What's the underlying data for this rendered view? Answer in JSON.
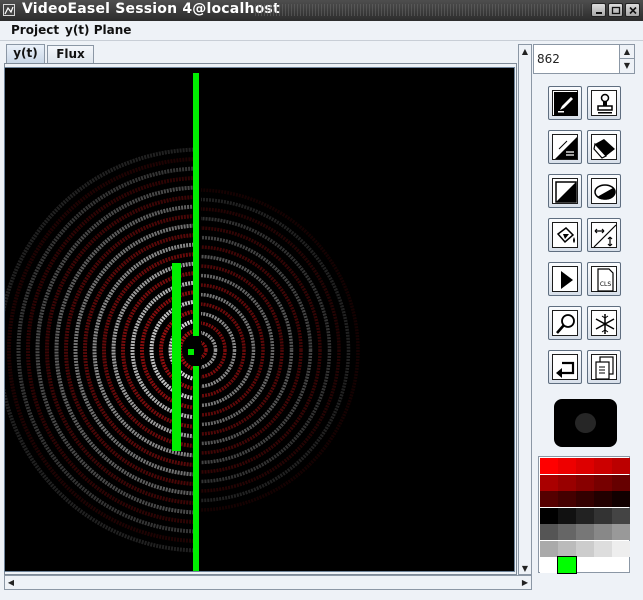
{
  "window": {
    "title": "VideoEasel Session 4@localhost"
  },
  "menubar": {
    "items": [
      "Project",
      "y(t) Plane"
    ]
  },
  "tabs": [
    {
      "label": "y(t)",
      "active": true
    },
    {
      "label": "Flux",
      "active": false
    }
  ],
  "spinner": {
    "value": "862"
  },
  "tools": [
    "pencil-icon",
    "stamp-icon",
    "gradient-fill-icon",
    "eraser-icon",
    "rectangle-icon",
    "ellipse-icon",
    "paint-bucket-icon",
    "resize-icon",
    "play-icon",
    "clear-screen-icon",
    "zoom-icon",
    "freeze-icon",
    "undo-icon",
    "copy-icon"
  ],
  "tool_labels": {
    "clear": "CLS"
  },
  "palette": {
    "selected": "#00ff00",
    "colors": [
      [
        "#ff0000",
        "#ee0000",
        "#dd0000",
        "#cc0000",
        "#bb0000"
      ],
      [
        "#aa0000",
        "#990000",
        "#880000",
        "#770000",
        "#660000"
      ],
      [
        "#550000",
        "#440000",
        "#330000",
        "#220000",
        "#110000"
      ],
      [
        "#000000",
        "#111111",
        "#222222",
        "#333333",
        "#444444"
      ],
      [
        "#555555",
        "#666666",
        "#777777",
        "#888888",
        "#999999"
      ],
      [
        "#aaaaaa",
        "#bbbbbb",
        "#cccccc",
        "#dddddd",
        "#eeeeee"
      ],
      [
        "#ffffff",
        "#00ff00",
        "",
        "",
        ""
      ]
    ]
  },
  "colors": {
    "barrier": "#00ee00",
    "wave_red": "#a01010",
    "wave_white": "#e0e0e0"
  }
}
